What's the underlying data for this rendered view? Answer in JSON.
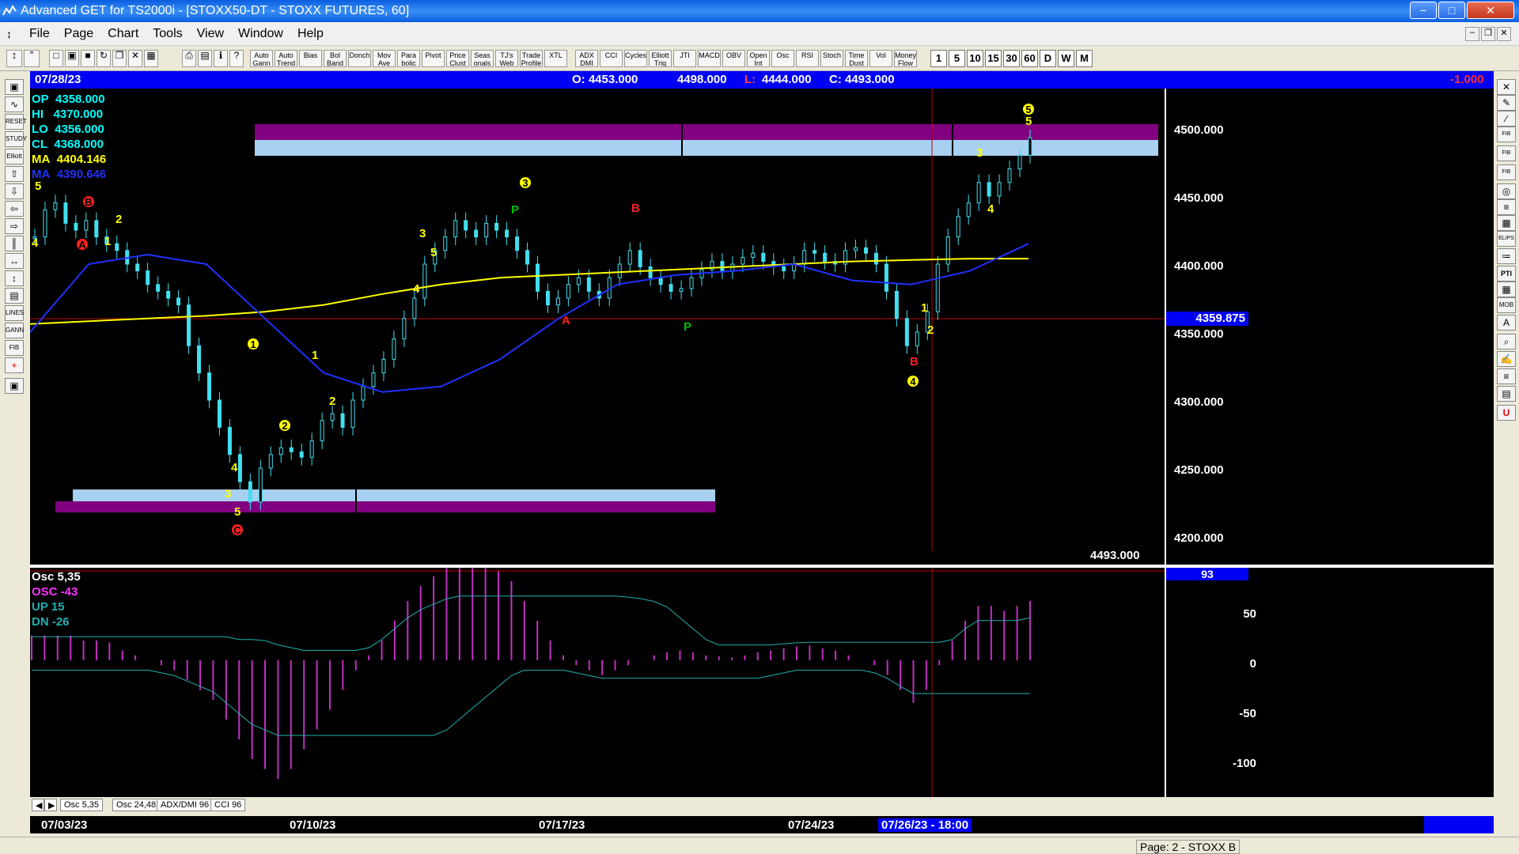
{
  "window": {
    "title": "Advanced GET for TS2000i - [STOXX50-DT - STOXX FUTURES, 60]"
  },
  "menu": [
    "File",
    "Page",
    "Chart",
    "Tools",
    "View",
    "Window",
    "Help"
  ],
  "toolbar": {
    "studies": [
      {
        "label": "Auto Gann",
        "name": "auto-gann-button"
      },
      {
        "label": "Auto Trend",
        "name": "auto-trend-button"
      },
      {
        "label": "Bias",
        "name": "bias-button"
      },
      {
        "label": "Bol Band",
        "name": "bol-band-button"
      },
      {
        "label": "Donch",
        "name": "donch-button"
      },
      {
        "label": "Mov Ave",
        "name": "mov-ave-button"
      },
      {
        "label": "Para bolic",
        "name": "parabolic-button"
      },
      {
        "label": "Pivot",
        "name": "pivot-button"
      },
      {
        "label": "Price Clust",
        "name": "price-clust-button"
      },
      {
        "label": "Seas onals",
        "name": "seasonals-button"
      },
      {
        "label": "TJ's Web",
        "name": "tjs-web-button"
      },
      {
        "label": "Trade Profile",
        "name": "trade-profile-button"
      },
      {
        "label": "XTL",
        "name": "xtl-button"
      },
      {
        "label": "ADX DMI",
        "name": "adx-dmi-button"
      },
      {
        "label": "CCI",
        "name": "cci-button"
      },
      {
        "label": "Cycles",
        "name": "cycles-button"
      },
      {
        "label": "Elliott Trig",
        "name": "elliott-trig-button"
      },
      {
        "label": "JTI",
        "name": "jti-button"
      },
      {
        "label": "MACD",
        "name": "macd-button"
      },
      {
        "label": "OBV",
        "name": "obv-button"
      },
      {
        "label": "Open Int",
        "name": "open-int-button"
      },
      {
        "label": "Osc",
        "name": "osc-button"
      },
      {
        "label": "RSI",
        "name": "rsi-button"
      },
      {
        "label": "Stoch",
        "name": "stoch-button"
      },
      {
        "label": "Time Dust",
        "name": "time-dust-button"
      },
      {
        "label": "Vol",
        "name": "vol-button"
      },
      {
        "label": "Money Flow",
        "name": "money-flow-button"
      }
    ],
    "intervals": [
      "1",
      "5",
      "10",
      "15",
      "30",
      "60",
      "D",
      "W",
      "M"
    ]
  },
  "header": {
    "date": "07/28/23",
    "open": "O: 4453.000",
    "high": "4498.000",
    "low_label": "L:",
    "low": "4444.000",
    "close": "C: 4493.000",
    "change": "-1.000"
  },
  "info": [
    {
      "label": "OP",
      "value": "4358.000",
      "color": "#00ffff"
    },
    {
      "label": "HI",
      "value": "4370.000",
      "color": "#00ffff"
    },
    {
      "label": "LO",
      "value": "4356.000",
      "color": "#00ffff"
    },
    {
      "label": "CL",
      "value": "4368.000",
      "color": "#00ffff"
    },
    {
      "label": "MA",
      "value": "4404.146",
      "color": "#ffff00"
    },
    {
      "label": "MA",
      "value": "4390.646",
      "color": "#0000ff"
    }
  ],
  "price_axis": [
    "4500.000",
    "4450.000",
    "4400.000",
    "4350.000",
    "4300.000",
    "4250.000",
    "4200.000"
  ],
  "cursor_price": "4359.875",
  "last_price": "4493.000",
  "osc_info": {
    "title": "Osc 5,35",
    "osc": "OSC -43",
    "up": "UP   15",
    "dn": "DN   -26"
  },
  "osc_axis": [
    "50",
    "0",
    "-50",
    "-100"
  ],
  "osc_value": "93",
  "tabs": [
    "Osc 5,35",
    "Osc 24,48",
    "ADX/DMI 96",
    "CCI 96"
  ],
  "dates": [
    "07/03/23",
    "07/10/23",
    "07/17/23",
    "07/24/23"
  ],
  "cursor_date": "07/26/23 - 18:00",
  "status": "Page: 2 - STOXX B",
  "chart_data": {
    "type": "candlestick",
    "series": [
      {
        "name": "price",
        "values": [
          4420,
          4440,
          4445,
          4430,
          4425,
          4432,
          4420,
          4415,
          4410,
          4400,
          4395,
          4385,
          4380,
          4375,
          4370,
          4340,
          4320,
          4300,
          4280,
          4260,
          4240,
          4225,
          4250,
          4260,
          4265,
          4262,
          4258,
          4270,
          4285,
          4290,
          4280,
          4300,
          4310,
          4320,
          4330,
          4345,
          4360,
          4375,
          4400,
          4410,
          4420,
          4432,
          4425,
          4420,
          4430,
          4425,
          4420,
          4410,
          4400,
          4380,
          4370,
          4375,
          4385,
          4390,
          4380,
          4375,
          4390,
          4400,
          4410,
          4398,
          4390,
          4385,
          4380,
          4382,
          4390,
          4396,
          4402,
          4395,
          4400,
          4405,
          4408,
          4402,
          4398,
          4395,
          4400,
          4410,
          4408,
          4402,
          4400,
          4410,
          4412,
          4408,
          4400,
          4380,
          4360,
          4340,
          4350,
          4365,
          4400,
          4420,
          4435,
          4445,
          4460,
          4450,
          4460,
          4470,
          4480,
          4493
        ]
      },
      {
        "name": "MA",
        "values": [
          4356,
          4358,
          4360,
          4362,
          4365,
          4370,
          4378,
          4385,
          4390,
          4392,
          4394,
          4396,
          4398,
          4400,
          4402,
          4403,
          4404,
          4404
        ]
      },
      {
        "name": "MA",
        "values": [
          4350,
          4400,
          4407,
          4400,
          4360,
          4320,
          4306,
          4310,
          4330,
          4360,
          4385,
          4392,
          4395,
          4400,
          4388,
          4385,
          4395,
          4415
        ]
      }
    ],
    "osc_values": [
      25,
      25,
      25,
      25,
      20,
      20,
      18,
      10,
      5,
      0,
      -5,
      -10,
      -20,
      -30,
      -40,
      -60,
      -80,
      -100,
      -110,
      -120,
      -110,
      -90,
      -70,
      -50,
      -30,
      -10,
      5,
      20,
      40,
      60,
      75,
      85,
      95,
      100,
      98,
      95,
      90,
      80,
      60,
      40,
      20,
      5,
      -5,
      -10,
      -15,
      -10,
      -5,
      0,
      5,
      8,
      10,
      8,
      5,
      4,
      3,
      5,
      8,
      10,
      12,
      14,
      15,
      12,
      10,
      5,
      0,
      -5,
      -15,
      -30,
      -43,
      -30,
      -5,
      20,
      40,
      55,
      55,
      50,
      55,
      60
    ],
    "levels": [
      "4500.000",
      "4200.000"
    ]
  }
}
